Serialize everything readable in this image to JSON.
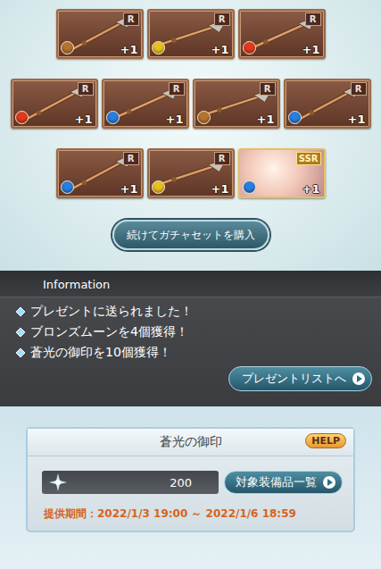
{
  "results": [
    [
      {
        "kind": "weapon",
        "rarity": "R",
        "count": "+1",
        "color": "#b5742e"
      },
      {
        "kind": "weapon",
        "rarity": "R",
        "count": "+1",
        "color": "#e8c020"
      },
      {
        "kind": "weapon",
        "rarity": "R",
        "count": "+1",
        "color": "#e03a1c"
      }
    ],
    [
      {
        "kind": "weapon",
        "rarity": "R",
        "count": "+1",
        "color": "#e03a1c"
      },
      {
        "kind": "weapon",
        "rarity": "R",
        "count": "+1",
        "color": "#2a7ee0"
      },
      {
        "kind": "weapon",
        "rarity": "R",
        "count": "+1",
        "color": "#b5742e"
      },
      {
        "kind": "weapon",
        "rarity": "R",
        "count": "+1",
        "color": "#2a7ee0"
      }
    ],
    [
      {
        "kind": "weapon",
        "rarity": "R",
        "count": "+1",
        "color": "#2a7ee0"
      },
      {
        "kind": "weapon",
        "rarity": "R",
        "count": "+1",
        "color": "#e8c020"
      },
      {
        "kind": "character",
        "rarity": "SSR",
        "count": "+1",
        "color": "#2a7ee0"
      }
    ]
  ],
  "repeat_button": "続けてガチャセットを購入",
  "information": {
    "title": "Information",
    "messages": [
      "プレゼントに送られました！",
      "ブロンズムーンを4個獲得！",
      "蒼光の御印を10個獲得！"
    ]
  },
  "present_button": "プレゼントリストへ",
  "currency": {
    "title": "蒼光の御印",
    "help": "HELP",
    "amount": "200",
    "list_button": "対象装備品一覧",
    "period": "提供期間：2022/1/3 19:00 ～ 2022/1/6 18:59"
  }
}
